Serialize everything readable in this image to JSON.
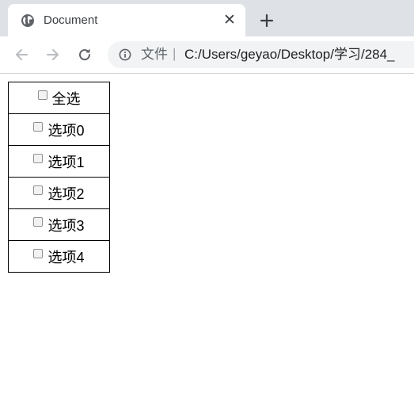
{
  "browser": {
    "tab": {
      "title": "Document",
      "close_glyph": "✕",
      "favicon": "globe-icon"
    },
    "new_tab_icon": "plus-icon",
    "nav": {
      "back_icon": "arrow-left-icon",
      "forward_icon": "arrow-right-icon",
      "reload_icon": "reload-icon"
    },
    "omnibox": {
      "info_icon": "info-icon",
      "scheme_label": "文件",
      "separator": "|",
      "url": "C:/Users/geyao/Desktop/学习/284_"
    }
  },
  "page": {
    "select_all": {
      "label": "全选",
      "checked": false
    },
    "options": [
      {
        "label": "选项0",
        "checked": false
      },
      {
        "label": "选项1",
        "checked": false
      },
      {
        "label": "选项2",
        "checked": false
      },
      {
        "label": "选项3",
        "checked": false
      },
      {
        "label": "选项4",
        "checked": false
      }
    ]
  }
}
